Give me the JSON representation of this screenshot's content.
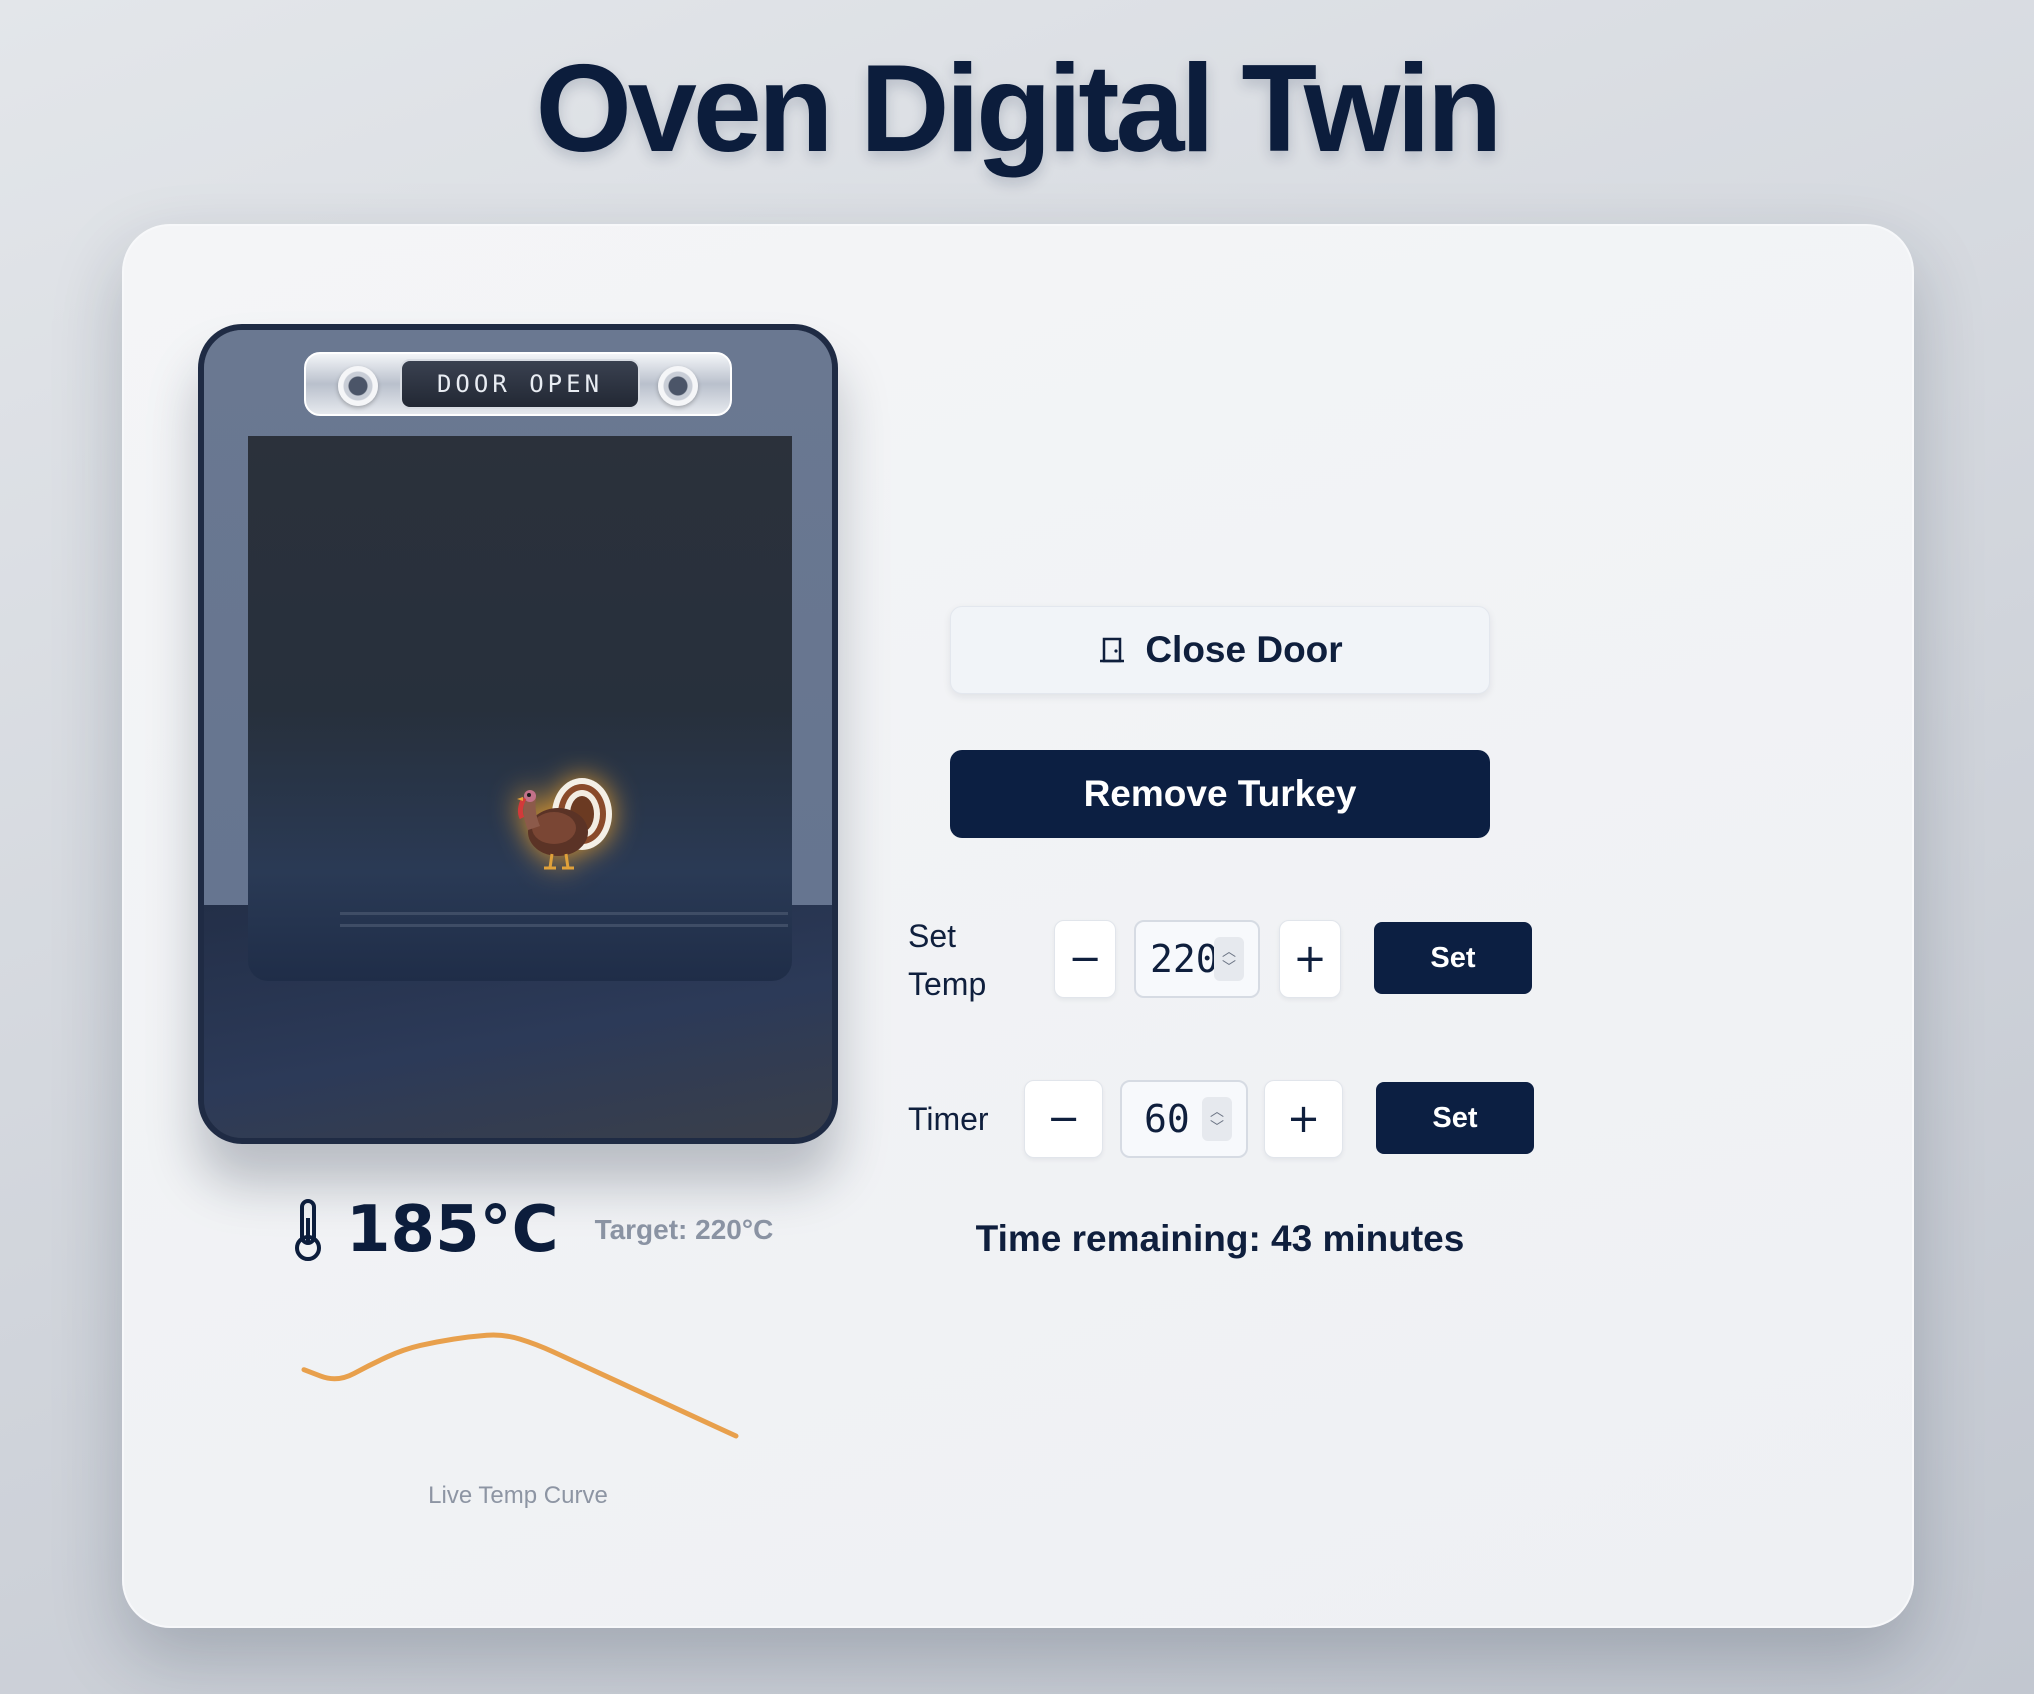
{
  "title": "Oven Digital Twin",
  "oven": {
    "display_text": "DOOR OPEN",
    "door_state": "open",
    "contents": "turkey"
  },
  "readout": {
    "current_temp": "185°C",
    "target_temp": "Target: 220°C"
  },
  "chart_data": {
    "type": "line",
    "title": "",
    "xlabel": "",
    "ylabel": "",
    "caption": "Live Temp Curve",
    "series": [
      {
        "values": [
          168,
          163,
          170,
          176,
          179,
          181,
          182,
          178,
          172,
          166,
          160,
          154,
          148,
          142
        ]
      }
    ],
    "color": "#e8a04c",
    "grid": false
  },
  "controls": {
    "door_button_label": "Close Door",
    "turkey_button_label": "Remove Turkey",
    "temp_label": "Set Temp",
    "temp_value": "220",
    "temp_minus": "−",
    "temp_plus": "+",
    "temp_set_label": "Set",
    "timer_label": "Timer",
    "timer_value": "60",
    "timer_minus": "−",
    "timer_plus": "+",
    "timer_set_label": "Set",
    "time_remaining": "Time remaining: 43 minutes"
  },
  "colors": {
    "navy": "#0c1f42",
    "curve": "#e8a04c",
    "muted": "#8a93a3"
  }
}
